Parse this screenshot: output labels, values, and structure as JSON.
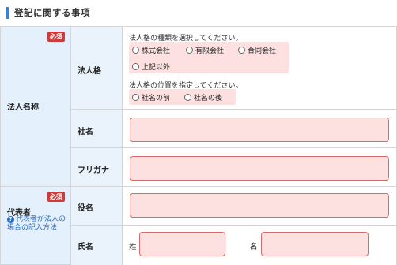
{
  "section": {
    "title": "登記に関する事項"
  },
  "required_badge": "必須",
  "corporate_name": {
    "group_label": "法人名称",
    "corp_type": {
      "label": "法人格",
      "type_instruction": "法人格の種類を選択してください。",
      "type_options": [
        "株式会社",
        "有限会社",
        "合同会社",
        "上記以外"
      ],
      "position_instruction": "法人格の位置を指定してください。",
      "position_options": [
        "社名の前",
        "社名の後"
      ]
    },
    "company_name": {
      "label": "社名",
      "value": ""
    },
    "furigana": {
      "label": "フリガナ",
      "value": ""
    }
  },
  "representative": {
    "group_label": "代表者",
    "help_link": "代表者が法人の場合の記入方法",
    "title": {
      "label": "役名",
      "value": ""
    },
    "name": {
      "label": "氏名",
      "last_name_label": "姓",
      "first_name_label": "名",
      "last_name_value": "",
      "first_name_value": ""
    }
  }
}
